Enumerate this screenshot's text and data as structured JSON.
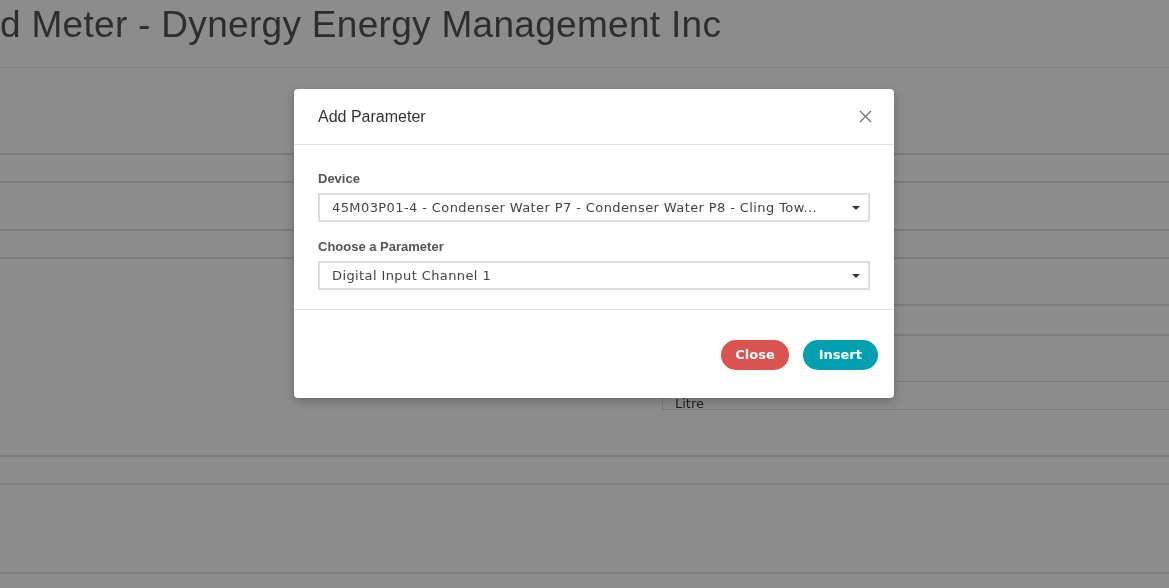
{
  "page": {
    "title": "d Meter - Dynergy Energy Management Inc",
    "unit_field": {
      "value": "Litre"
    }
  },
  "modal": {
    "title": "Add Parameter",
    "fields": [
      {
        "label": "Device",
        "value": "45M03P01-4 - Condenser Water P7 - Condenser Water P8 - Cling Tow..."
      },
      {
        "label": "Choose a Parameter",
        "value": "Digital Input Channel 1"
      }
    ],
    "buttons": [
      {
        "label": "Close",
        "kind": "danger"
      },
      {
        "label": "Insert",
        "kind": "primary"
      }
    ]
  }
}
